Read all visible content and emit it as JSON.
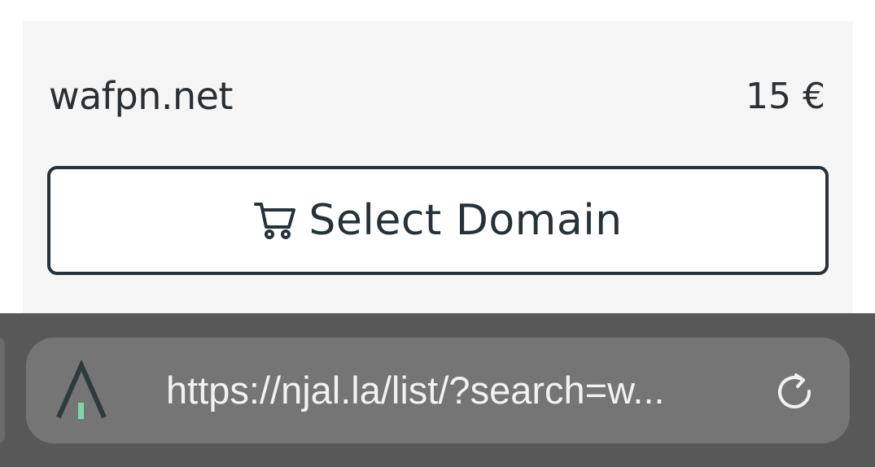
{
  "listing": {
    "domain": "wafpn.net",
    "price": "15 €",
    "select_button_label": "Select Domain",
    "select_button_icon": "cart-icon"
  },
  "browser": {
    "url": "https://njal.la/list/?search=w...",
    "site_icon": "njalla-logo-icon",
    "reload_icon": "reload-icon"
  },
  "colors": {
    "text_dark": "#263238",
    "card_bg": "#f5f5f5",
    "toolbar_bg": "#585858",
    "url_pill_bg": "#757575",
    "logo_accent": "#7fd6a8"
  }
}
